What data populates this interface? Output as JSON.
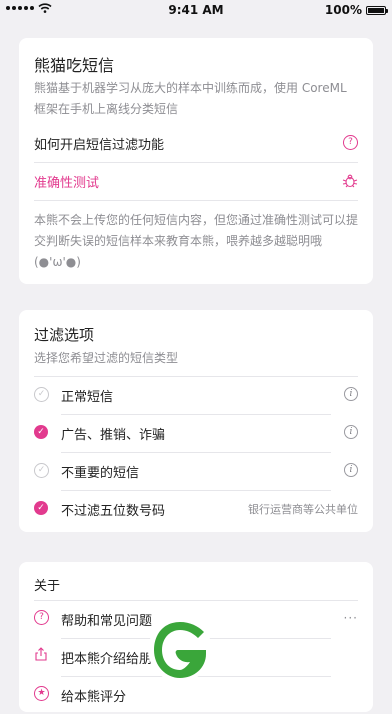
{
  "status_bar": {
    "time": "9:41 AM",
    "battery": "100%"
  },
  "card1": {
    "title": "熊猫吃短信",
    "description": "熊猫基于机器学习从庞大的样本中训练而成，使用 CoreML 框架在手机上离线分类短信",
    "rows": [
      {
        "label": "如何开启短信过滤功能",
        "icon": "question-circle-icon"
      },
      {
        "label": "准确性测试",
        "icon": "bug-icon"
      }
    ],
    "footer": "本熊不会上传您的任何短信内容，但您通过准确性测试可以提交判断失误的短信样本来教育本熊，喂养越多越聪明哦 (●'ω'●)"
  },
  "card2": {
    "title": "过滤选项",
    "subtitle": "选择您希望过滤的短信类型",
    "options": [
      {
        "label": "正常短信",
        "checked": false,
        "trail": "info-icon"
      },
      {
        "label": "广告、推销、诈骗",
        "checked": true,
        "trail": "info-icon"
      },
      {
        "label": "不重要的短信",
        "checked": false,
        "trail": "info-icon"
      },
      {
        "label": "不过滤五位数号码",
        "checked": true,
        "trail_text": "银行运营商等公共单位"
      }
    ]
  },
  "card3": {
    "title": "关于",
    "rows": [
      {
        "label": "帮助和常见问题",
        "icon": "question-circle-icon",
        "trail": "more-icon"
      },
      {
        "label": "把本熊介绍给朋友",
        "icon": "share-icon"
      },
      {
        "label": "给本熊评分",
        "icon": "star-icon"
      }
    ]
  },
  "colors": {
    "accent": "#e23a8e",
    "background": "#f1f0f3",
    "logo_green": "#3aa63a"
  }
}
